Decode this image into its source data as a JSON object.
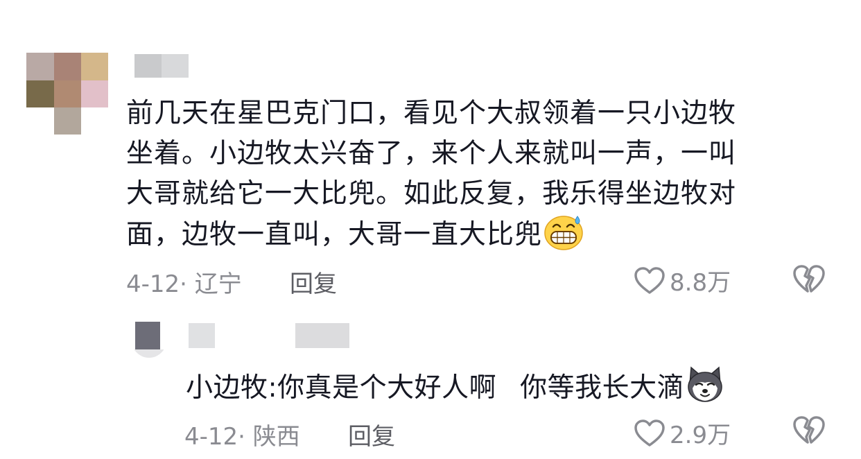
{
  "comment": {
    "lines": [
      "前几天在星巴克门口，看见个大叔领着一只小边牧",
      "坐着。小边牧太兴奋了，来个人来就叫一声，一叫",
      "大哥就给它一大比兜。如此反复，我乐得坐边牧对",
      "面，边牧一直叫，大哥一直大比兜"
    ],
    "emoji": "grinning-sweat-emoji",
    "date": "4-12",
    "location": "· 辽宁",
    "reply_label": "回复",
    "likes": "8.8万"
  },
  "reply": {
    "text_part1": "小边牧:你真是个大好人啊",
    "text_part2": "你等我长大滴",
    "emoji": "husky-dog-emoji",
    "date": "4-12",
    "location": "· 陕西",
    "reply_label": "回复",
    "likes": "2.9万"
  },
  "colors": {
    "text": "#161823",
    "meta": "#8a8b91",
    "reply_button": "#5c5d63",
    "background": "#ffffff"
  }
}
